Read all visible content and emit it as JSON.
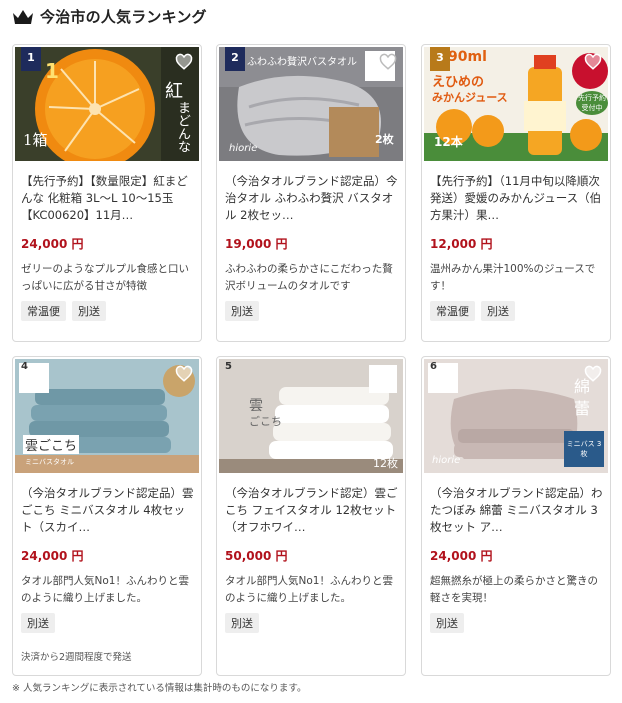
{
  "header": {
    "title": "今治市の人気ランキング",
    "icon": "crown-icon"
  },
  "colors": {
    "price": "#b1121c",
    "rank_badge": "#1e2b5c",
    "tag_bg": "#eeeeee"
  },
  "items": [
    {
      "rank": "1",
      "image_text": [
        "紅",
        "まどんな",
        "1箱",
        "1"
      ],
      "title": "【先行予約】【数量限定】紅まどんな 化粧箱 3L～L 10～15玉【KC00620】11月…",
      "price": "24,000 円",
      "desc": "ゼリーのようなプルプル食感と口いっぱいに広がる甘さが特徴",
      "tags": [
        "常温便",
        "別送"
      ]
    },
    {
      "rank": "2",
      "image_text": [
        "ふわふわ贅沢バスタオル",
        "hiorie",
        "2枚"
      ],
      "title": "（今治タオルブランド認定品）今治タオル ふわふわ贅沢 バスタオル 2枚セッ…",
      "price": "19,000 円",
      "desc": "ふわふわの柔らかさにこだわった贅沢ボリュームのタオルです",
      "tags": [
        "別送"
      ]
    },
    {
      "rank": "3",
      "image_text": [
        "90ml",
        "えひめの",
        "みかんジュース",
        "12本",
        "先行予約受付中"
      ],
      "title": "【先行予約】（11月中旬以降順次発送）愛媛のみかんジュース（伯方果汁）果…",
      "price": "12,000 円",
      "desc": "温州みかん果汁100%のジュースです！",
      "tags": [
        "常温便",
        "別送"
      ]
    },
    {
      "rank": "4",
      "image_text": [
        "雲ごこち",
        "ミニバスタオル"
      ],
      "title": "（今治タオルブランド認定品）雲ごこち ミニバスタオル 4枚セット（スカイ…",
      "price": "24,000 円",
      "desc": "タオル部門人気No1！ふんわりと雲のように織り上げました。",
      "tags": [
        "別送"
      ],
      "ship_note": "決済から2週間程度で発送"
    },
    {
      "rank": "5",
      "image_text": [
        "雲",
        "ごこち",
        "12枚"
      ],
      "title": "（今治タオルブランド認定）雲ごこち フェイスタオル 12枚セット（オフホワイ…",
      "price": "50,000 円",
      "desc": "タオル部門人気No1！ふんわりと雲のように織り上げました。",
      "tags": [
        "別送"
      ]
    },
    {
      "rank": "6",
      "image_text": [
        "綿",
        "蕾",
        "hiorie",
        "ミニバス 3枚"
      ],
      "title": "（今治タオルブランド認定品）わたつぼみ 綿蕾 ミニバスタオル 3枚セット ア…",
      "price": "24,000 円",
      "desc": "超無撚糸が極上の柔らかさと驚きの軽さを実現！",
      "tags": [
        "別送"
      ]
    }
  ],
  "footnote": "※ 人気ランキングに表示されている情報は集計時のものになります。"
}
